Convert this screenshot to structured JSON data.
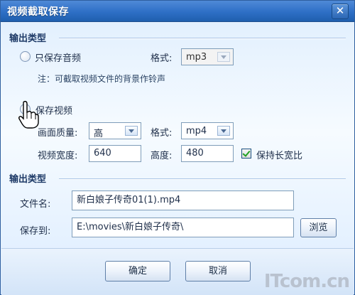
{
  "window": {
    "title": "视频截取保存"
  },
  "section1": {
    "title": "输出类型",
    "audio_only": {
      "label": "只保存音频",
      "selected": false
    },
    "audio_format": {
      "label": "格式:",
      "value": "mp3"
    },
    "note": "注：可截取视频文件的背景作铃声",
    "save_video": {
      "label": "保存视频",
      "selected": true
    },
    "quality": {
      "label": "画面质量:",
      "value": "高"
    },
    "video_format": {
      "label": "格式:",
      "value": "mp4"
    },
    "width": {
      "label": "视频宽度:",
      "value": "640"
    },
    "height": {
      "label": "高度:",
      "value": "480"
    },
    "keep_ratio": {
      "label": "保持长宽比",
      "checked": true
    }
  },
  "section2": {
    "title": "输出类型",
    "filename": {
      "label": "文件名:",
      "value": "新白娘子传奇01(1).mp4"
    },
    "save_to": {
      "label": "保存到:",
      "value": "E:\\movies\\新白娘子传奇\\"
    },
    "browse_label": "浏览"
  },
  "footer": {
    "ok_label": "确定",
    "cancel_label": "取消"
  },
  "watermark": {
    "text": "ITcom.cn"
  },
  "colors": {
    "titlebar": "#2e6fc6",
    "accent_check": "#21a121",
    "background": "#eaf3fd"
  }
}
